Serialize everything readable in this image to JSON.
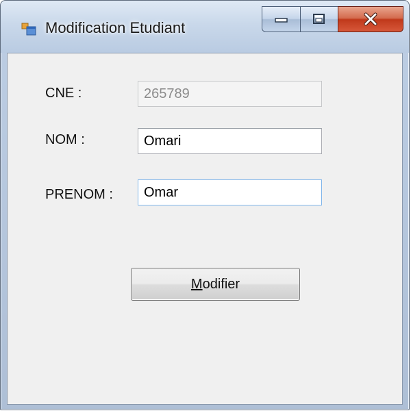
{
  "window": {
    "title": "Modification Etudiant",
    "app_icon": "windows-form-icon",
    "controls": {
      "minimize_icon": "minimize-icon",
      "maximize_icon": "maximize-icon",
      "close_icon": "close-icon"
    }
  },
  "form": {
    "cne": {
      "label": "CNE :",
      "value": "265789",
      "enabled": false
    },
    "nom": {
      "label": "NOM :",
      "value": "Omari"
    },
    "prenom": {
      "label": "PRENOM :",
      "value": "Omar"
    },
    "submit": {
      "mnemonic": "M",
      "label_rest": "odifier"
    }
  },
  "colors": {
    "client_bg": "#f0f0f0",
    "close_button": "#c9462a",
    "focus_border": "#7eb4ea"
  }
}
